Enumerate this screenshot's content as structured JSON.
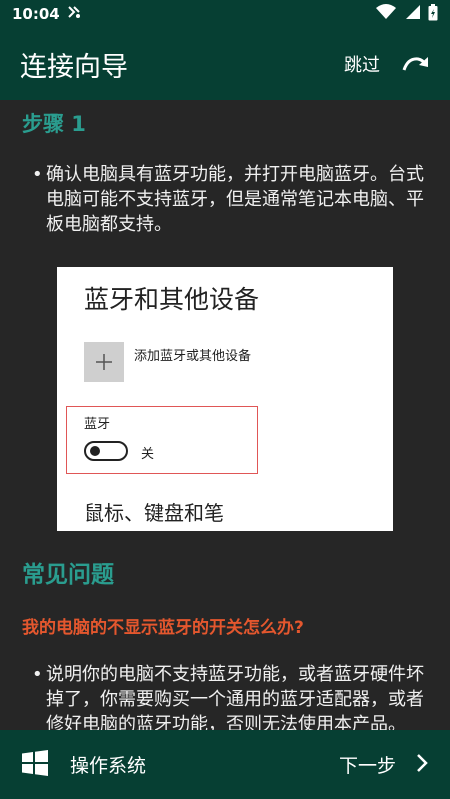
{
  "status": {
    "time": "10:04",
    "carrier_icon": "notification-icon"
  },
  "appbar": {
    "title": "连接向导",
    "skip": "跳过"
  },
  "step": {
    "title": "步骤 1",
    "bullet": "确认电脑具有蓝牙功能，并打开电脑蓝牙。台式电脑可能不支持蓝牙，但是通常笔记本电脑、平板电脑都支持。"
  },
  "screenshot": {
    "heading": "蓝牙和其他设备",
    "add_device": "添加蓝牙或其他设备",
    "bluetooth_label": "蓝牙",
    "toggle_state": "关",
    "mouse_keyboard": "鼠标、键盘和笔"
  },
  "faq": {
    "title": "常见问题",
    "question": "我的电脑的不显示蓝牙的开关怎么办?",
    "answer": "说明你的电脑不支持蓝牙功能，或者蓝牙硬件坏掉了，你需要购买一个通用的蓝牙适配器，或者修好电脑的蓝牙功能，否则无法使用本产品。😐😐😐"
  },
  "bottom": {
    "os_label": "操作系统",
    "next_label": "下一步"
  },
  "colors": {
    "bar": "#063f33",
    "accent": "#2a9d8f",
    "question": "#e4572e"
  }
}
